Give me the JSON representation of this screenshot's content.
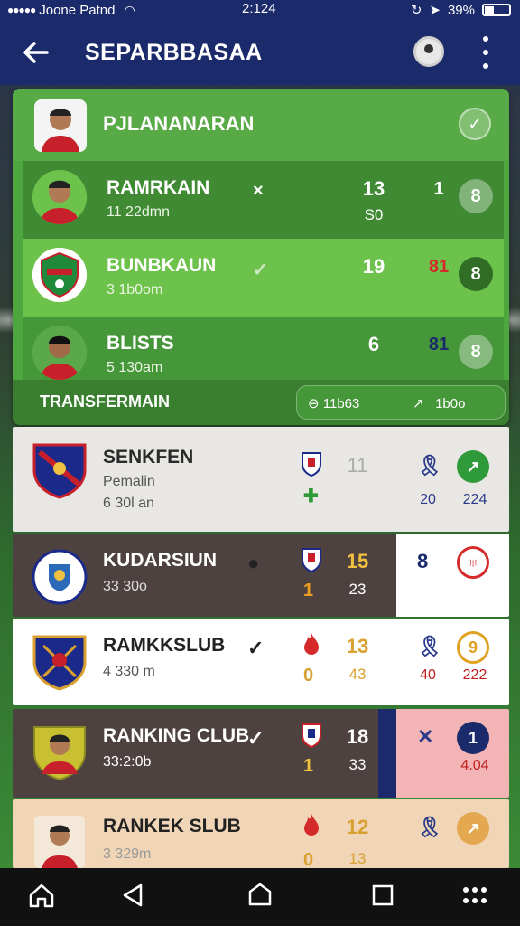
{
  "status": {
    "carrier": "Joone Patnd",
    "time": "2:124",
    "battery": "39%"
  },
  "header": {
    "title": "SEPARBBASAA"
  },
  "featured": {
    "heading": "PJLANANARAN",
    "rows": [
      {
        "name": "RAMRKAIN",
        "sub": "11 22dmn",
        "mark": "×",
        "num1": "13",
        "num1b": "S0",
        "num2": "1",
        "badge": "8"
      },
      {
        "name": "BUNBKAUN",
        "sub": "3 1b0om",
        "mark": "✓",
        "num1": "19",
        "num1b": "",
        "num2": "81",
        "badge": "8"
      },
      {
        "name": "BLISTS",
        "sub": "5 130am",
        "mark": "",
        "num1": "6",
        "num1b": "",
        "num2": "81",
        "badge": "8"
      }
    ],
    "footer_label": "TRANSFERMAIN",
    "footer_a": "11b63",
    "footer_b": "1b0o"
  },
  "clubs": [
    {
      "name": "SENKFEN",
      "sub": "Pemalin",
      "sub2": "6 30l an",
      "v1": "11",
      "v2": "",
      "v3": "20",
      "v4": "224",
      "mini2": "✚"
    },
    {
      "name": "KUDARSIUN",
      "sub": "33 30o",
      "v1": "15",
      "v2": "23",
      "v3": "8",
      "v4": "",
      "mini2": "1"
    },
    {
      "name": "RAMKKSLUB",
      "sub": "4 330 m",
      "v1": "13",
      "v2": "43",
      "v3": "40",
      "v4": "222",
      "mini2": "0"
    },
    {
      "name": "RANKING CLUB",
      "sub": "33:2:0b",
      "v1": "18",
      "v2": "33",
      "v3": "",
      "v4": "4.04",
      "mini2": "1"
    },
    {
      "name": "RANKEK SLUB",
      "sub": "3 329m",
      "v1": "12",
      "v2": "13",
      "v3": "",
      "v4": "",
      "mini2": "0"
    }
  ],
  "colors": {
    "navy": "#1b2a6b",
    "green": "#4ea63f",
    "accent_red": "#d42a2a",
    "gold": "#d8a030"
  }
}
